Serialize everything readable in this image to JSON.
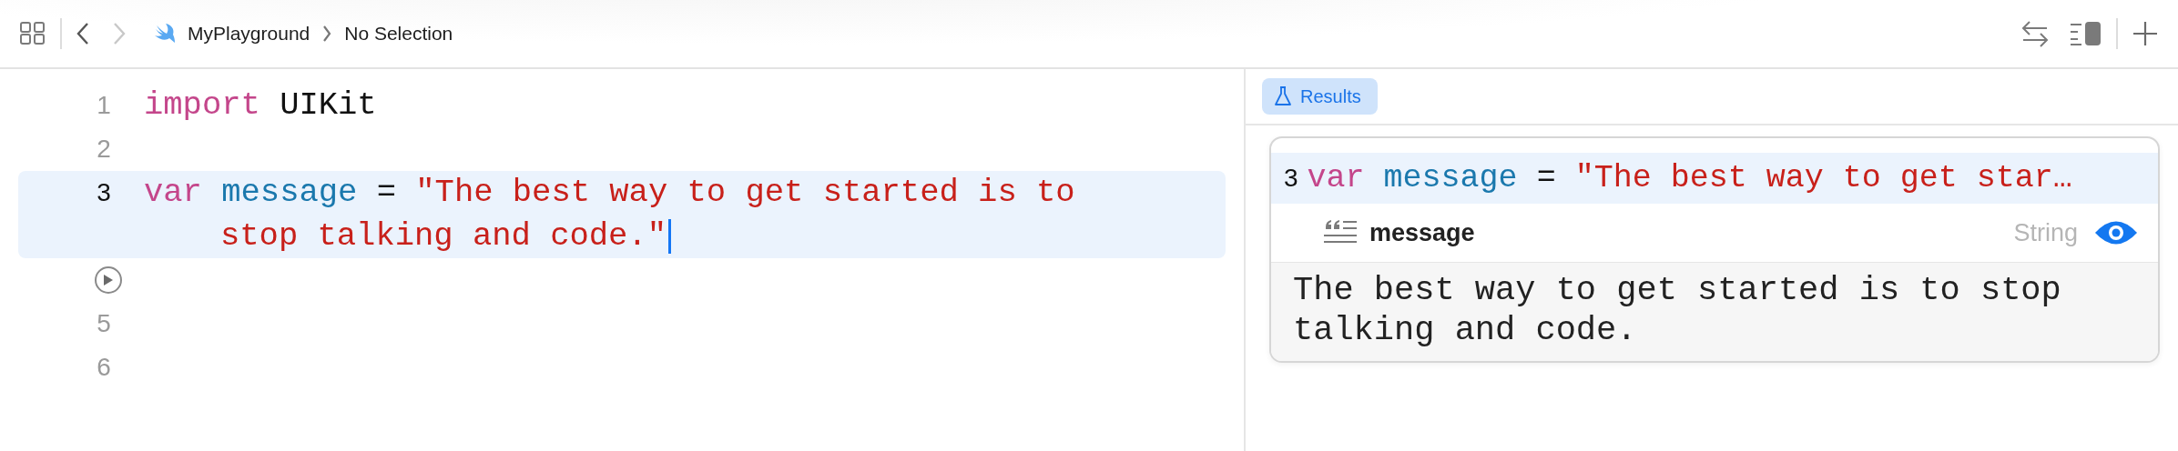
{
  "toolbar": {
    "breadcrumb": [
      {
        "kind": "project",
        "label": "MyPlayground"
      },
      {
        "kind": "item",
        "label": "No Selection"
      }
    ]
  },
  "editor": {
    "lines": [
      {
        "kind": "code",
        "number": "1",
        "current": false,
        "cursor": false,
        "tokens": [
          {
            "kind": "keyword",
            "s": "import"
          },
          {
            "kind": "plain",
            "s": " UIKit"
          }
        ]
      },
      {
        "kind": "code",
        "number": "2",
        "current": false,
        "cursor": false
      },
      {
        "kind": "code",
        "number": "3",
        "current": true,
        "cursor": true,
        "tokens": [
          {
            "kind": "keyword",
            "s": "var"
          },
          {
            "kind": "ident",
            "s": " message"
          },
          {
            "kind": "plain",
            "s": " = "
          },
          {
            "kind": "string",
            "s": "\"The best way to get started is to stop talking and code.\""
          }
        ]
      },
      {
        "kind": "run"
      },
      {
        "kind": "code",
        "number": "5",
        "current": false,
        "cursor": false
      },
      {
        "kind": "code",
        "number": "6",
        "current": false,
        "cursor": false
      }
    ]
  },
  "results": {
    "tab": {
      "label": "Results",
      "selected": true
    },
    "card": {
      "line_number": "3",
      "tokens": [
        {
          "kind": "keyword",
          "s": "var"
        },
        {
          "kind": "ident",
          "s": " message"
        },
        {
          "kind": "plain",
          "s": " = "
        },
        {
          "kind": "string",
          "s": "\"The best way to get star…"
        }
      ],
      "name": "message",
      "type": "String",
      "value": "The best way to get started is to stop talking and code."
    }
  }
}
